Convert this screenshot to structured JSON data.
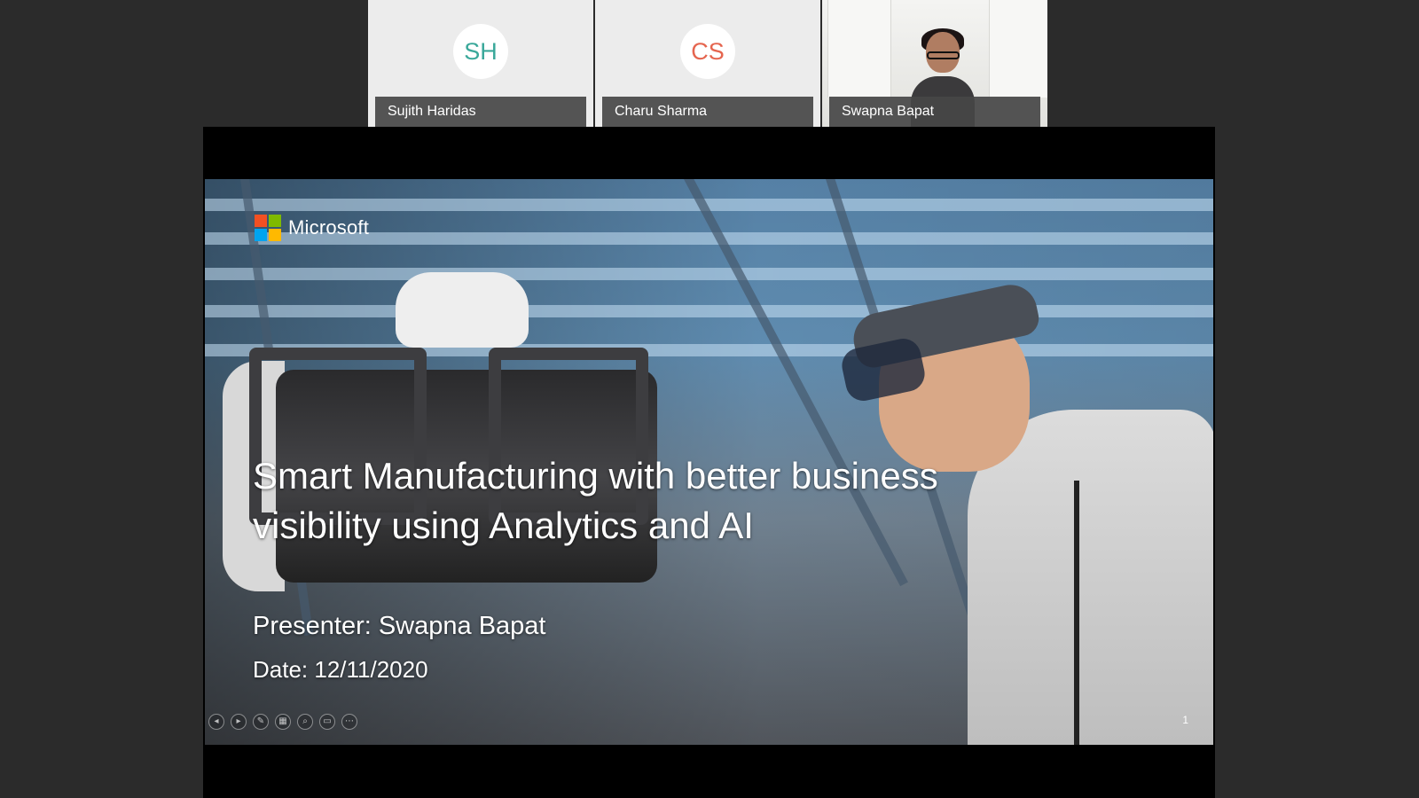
{
  "participants": [
    {
      "initials": "SH",
      "name": "Sujith Haridas",
      "initials_color": "#3aa89a"
    },
    {
      "initials": "CS",
      "name": "Charu Sharma",
      "initials_color": "#e5654f"
    },
    {
      "name": "Swapna Bapat",
      "has_video": true
    }
  ],
  "slide": {
    "brand": "Microsoft",
    "brand_colors": [
      "#f25022",
      "#7fba00",
      "#00a4ef",
      "#ffb900"
    ],
    "title": "Smart Manufacturing with better business visibility using Analytics and AI",
    "presenter": "Presenter: Swapna Bapat",
    "date": "Date: 12/11/2020",
    "page_number": "1"
  },
  "slideshow_controls": [
    {
      "name": "previous-slide-button",
      "icon": "chevron-left-icon",
      "glyph": "◂"
    },
    {
      "name": "next-slide-button",
      "icon": "chevron-right-icon",
      "glyph": "▸"
    },
    {
      "name": "pen-tool-button",
      "icon": "pen-icon",
      "glyph": "✎"
    },
    {
      "name": "all-slides-button",
      "icon": "grid-icon",
      "glyph": "▦"
    },
    {
      "name": "zoom-button",
      "icon": "magnifier-icon",
      "glyph": "⌕"
    },
    {
      "name": "screen-button",
      "icon": "screen-icon",
      "glyph": "▭"
    },
    {
      "name": "more-options-button",
      "icon": "more-icon",
      "glyph": "⋯"
    }
  ]
}
